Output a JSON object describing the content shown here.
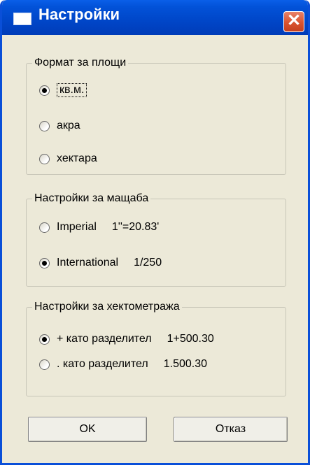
{
  "window": {
    "title": "Настройки",
    "close_symbol": "✕"
  },
  "area_format": {
    "legend": "Формат за площи",
    "options": [
      {
        "label": "кв.м.",
        "checked": true
      },
      {
        "label": "акра",
        "checked": false
      },
      {
        "label": "хектара",
        "checked": false
      }
    ]
  },
  "scale_settings": {
    "legend": "Настройки за мащаба",
    "options": [
      {
        "label": "Imperial",
        "value": "1''=20.83'",
        "checked": false
      },
      {
        "label": "International",
        "value": "1/250",
        "checked": true
      }
    ]
  },
  "chainage_settings": {
    "legend": "Настройки за хектометража",
    "options": [
      {
        "label": "+ като разделител",
        "value": "1+500.30",
        "checked": true
      },
      {
        "label": ". като разделител",
        "value": "1.500.30",
        "checked": false
      }
    ]
  },
  "buttons": {
    "ok": "OK",
    "cancel": "Отказ"
  }
}
